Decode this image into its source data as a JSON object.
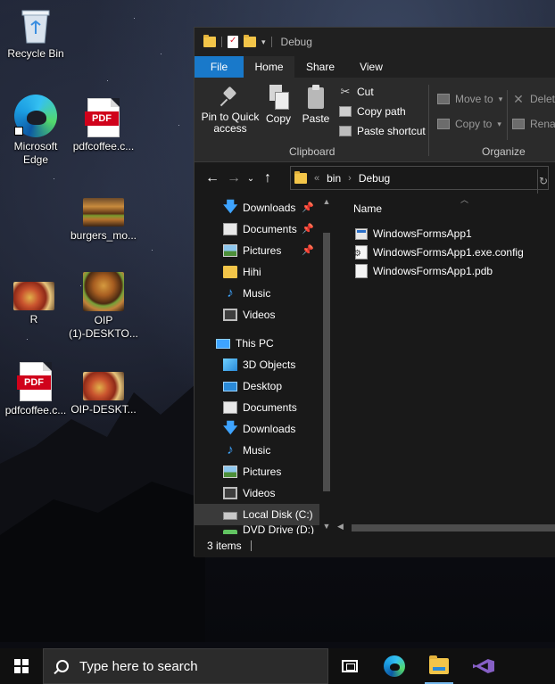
{
  "desktop": {
    "icons": [
      {
        "name": "recycle-bin",
        "label": "Recycle Bin"
      },
      {
        "name": "edge",
        "label": "Microsoft\nEdge"
      },
      {
        "name": "pdf-1",
        "label": "pdfcoffee.c..."
      },
      {
        "name": "burgers",
        "label": "burgers_mo..."
      },
      {
        "name": "r",
        "label": "R"
      },
      {
        "name": "oip-1",
        "label": "OIP\n(1)-DESKTO..."
      },
      {
        "name": "pdf-2",
        "label": "pdfcoffee.c..."
      },
      {
        "name": "oip-desktop",
        "label": "OIP-DESKT..."
      }
    ]
  },
  "window": {
    "title": "Debug",
    "tabs": {
      "file": "File",
      "home": "Home",
      "share": "Share",
      "view": "View"
    },
    "ribbon": {
      "pin_label": "Pin to Quick\naccess",
      "copy_label": "Copy",
      "paste_label": "Paste",
      "cut_label": "Cut",
      "copy_path_label": "Copy path",
      "paste_shortcut_label": "Paste shortcut",
      "clipboard_group": "Clipboard",
      "move_to_label": "Move to",
      "copy_to_label": "Copy to",
      "delete_label": "Delete",
      "rename_label": "Rename",
      "organize_group": "Organize"
    },
    "address": {
      "crumb_overflow": "«",
      "crumbs": [
        "bin",
        "Debug"
      ]
    },
    "nav": {
      "quick_access": [
        {
          "label": "Downloads",
          "pinned": true
        },
        {
          "label": "Documents",
          "pinned": true
        },
        {
          "label": "Pictures",
          "pinned": true
        },
        {
          "label": "Hihi",
          "pinned": false
        },
        {
          "label": "Music",
          "pinned": false
        },
        {
          "label": "Videos",
          "pinned": false
        }
      ],
      "this_pc_label": "This PC",
      "this_pc": [
        {
          "label": "3D Objects"
        },
        {
          "label": "Desktop"
        },
        {
          "label": "Documents"
        },
        {
          "label": "Downloads"
        },
        {
          "label": "Music"
        },
        {
          "label": "Pictures"
        },
        {
          "label": "Videos"
        },
        {
          "label": "Local Disk (C:)"
        },
        {
          "label": "DVD Drive (D:) E..."
        }
      ]
    },
    "content": {
      "column_name": "Name",
      "files": [
        {
          "name": "WindowsFormsApp1",
          "type": "exe"
        },
        {
          "name": "WindowsFormsApp1.exe.config",
          "type": "config"
        },
        {
          "name": "WindowsFormsApp1.pdb",
          "type": "pdb"
        }
      ]
    },
    "status": {
      "items_count": "3 items"
    }
  },
  "taskbar": {
    "search_placeholder": "Type here to search"
  },
  "colors": {
    "file_tab": "#1979ca",
    "ribbon_bg": "#2b2b2b",
    "window_bg": "#191919",
    "accent_blue": "#3ea4ff"
  }
}
